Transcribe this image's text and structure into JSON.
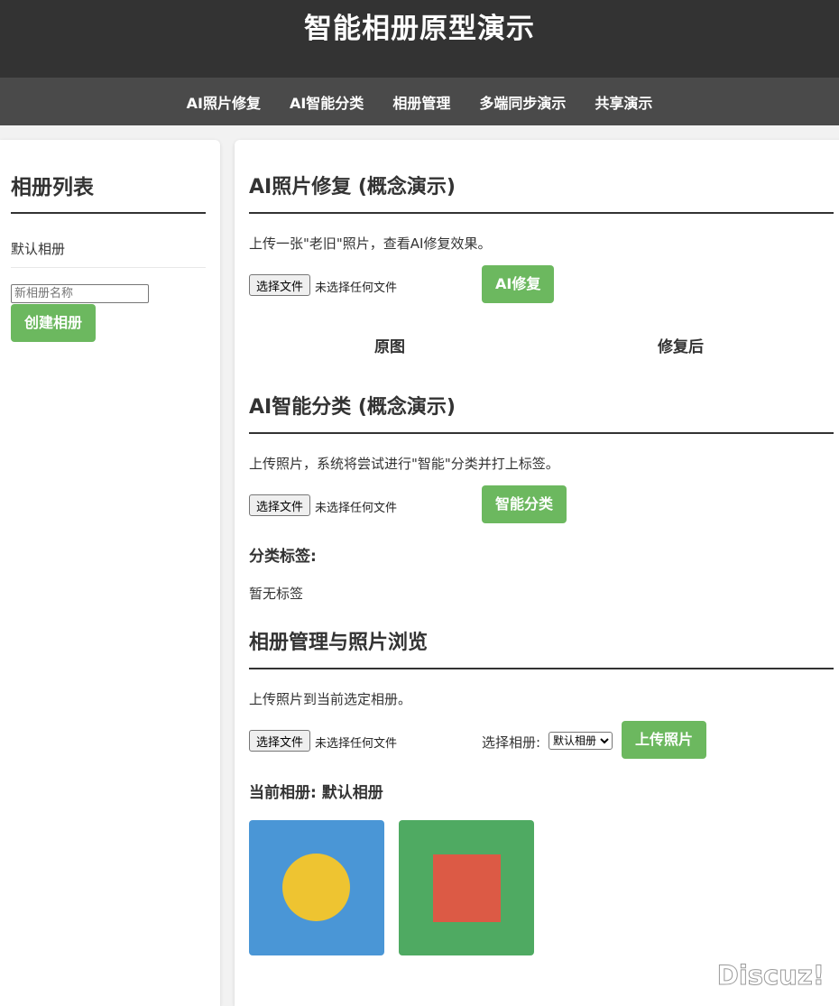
{
  "header": {
    "title": "智能相册原型演示"
  },
  "nav": {
    "items": [
      {
        "label": "AI照片修复"
      },
      {
        "label": "AI智能分类"
      },
      {
        "label": "相册管理"
      },
      {
        "label": "多端同步演示"
      },
      {
        "label": "共享演示"
      }
    ]
  },
  "sidebar": {
    "title": "相册列表",
    "albums": [
      {
        "name": "默认相册"
      }
    ],
    "new_album_placeholder": "新相册名称",
    "create_button": "创建相册"
  },
  "repair": {
    "title": "AI照片修复 (概念演示)",
    "description": "上传一张\"老旧\"照片，查看AI修复效果。",
    "file_button": "选择文件",
    "file_status": "未选择任何文件",
    "action_button": "AI修复",
    "original_label": "原图",
    "repaired_label": "修复后"
  },
  "classify": {
    "title": "AI智能分类 (概念演示)",
    "description": "上传照片，系统将尝试进行\"智能\"分类并打上标签。",
    "file_button": "选择文件",
    "file_status": "未选择任何文件",
    "action_button": "智能分类",
    "tags_heading": "分类标签:",
    "tags_empty": "暂无标签"
  },
  "manage": {
    "title": "相册管理与照片浏览",
    "description": "上传照片到当前选定相册。",
    "file_button": "选择文件",
    "file_status": "未选择任何文件",
    "select_label": "选择相册:",
    "select_value": "默认相册",
    "upload_button": "上传照片",
    "current_album_label": "当前相册: 默认相册",
    "photos": [
      {
        "background": "#4a96d6",
        "shape": "circle",
        "shape_color": "#eec431"
      },
      {
        "background": "#4faa62",
        "shape": "square",
        "shape_color": "#dc5a45"
      }
    ]
  },
  "colors": {
    "header_bg": "#333333",
    "nav_bg": "#4a4a4a",
    "accent_green": "#6cb85f"
  },
  "watermark": "Discuz!"
}
